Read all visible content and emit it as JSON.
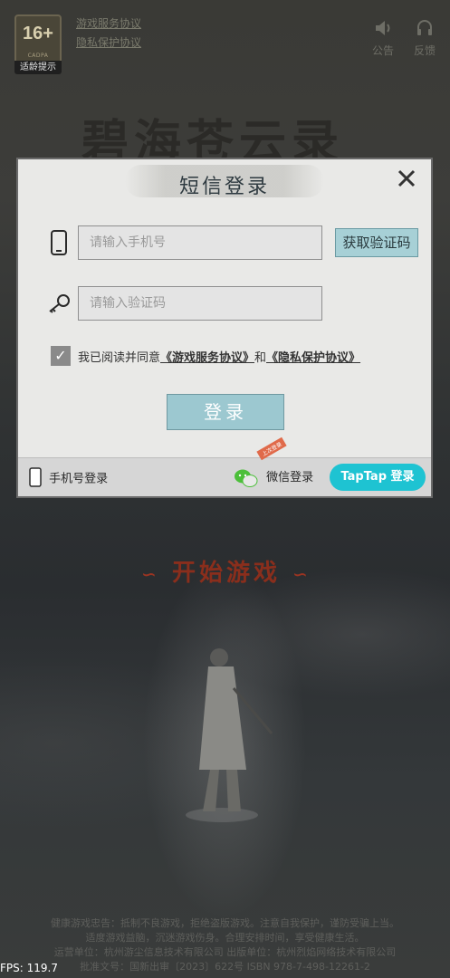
{
  "top": {
    "age_rating": "16+",
    "age_small": "CADPA",
    "age_label": "适龄提示",
    "links": [
      "游戏服务协议",
      "隐私保护协议"
    ],
    "notice_btn": "公告",
    "feedback_btn": "反馈"
  },
  "logo_text": "碧海苍云录",
  "dialog": {
    "title": "短信登录",
    "phone_placeholder": "请输入手机号",
    "get_code": "获取验证码",
    "code_placeholder": "请输入验证码",
    "agree_prefix": "我已阅读并同意",
    "terms": "《游戏服务协议》",
    "and": "和",
    "privacy": "《隐私保护协议》",
    "login": "登录",
    "phone_login": "手机号登录",
    "wechat_login": "微信登录",
    "wechat_badge": "上次登录",
    "taptap_login": "TapTap 登录"
  },
  "start_game": "开始游戏",
  "health_notice": [
    "健康游戏忠告：抵制不良游戏，拒绝盗版游戏。注意自我保护，谨防受骗上当。",
    "适度游戏益脑，沉迷游戏伤身。合理安排时间，享受健康生活。",
    "运营单位：杭州游尘信息技术有限公司 出版单位：杭州烈焰网络技术有限公司",
    "批准文号：国新出审〔2023〕622号 ISBN 978-7-498-12261-2"
  ],
  "fps": "FPS: 119.7"
}
